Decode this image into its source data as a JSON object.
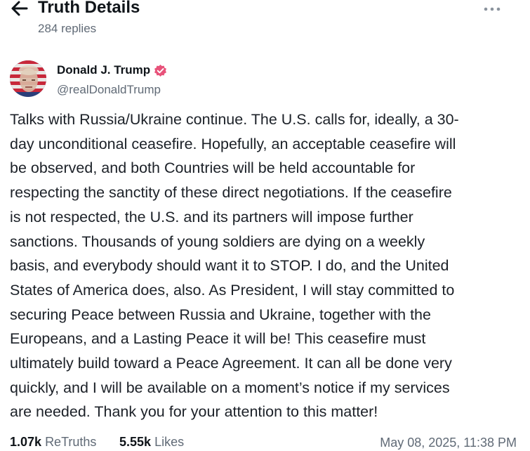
{
  "header": {
    "title": "Truth Details",
    "subtitle": "284 replies",
    "back_icon": "arrow-left-icon",
    "more_icon": "ellipsis-icon"
  },
  "author": {
    "name": "Donald J. Trump",
    "handle": "@realDonaldTrump",
    "verified": true,
    "verified_color": "#e8527a"
  },
  "post": {
    "text": "Talks with Russia/Ukraine continue. The U.S. calls for, ideally, a 30-\nday unconditional ceasefire. Hopefully, an acceptable ceasefire will\nbe observed, and both Countries will be held accountable for\nrespecting the sanctity of these direct negotiations. If the ceasefire\nis not respected, the U.S. and its partners will impose further\nsanctions. Thousands of young soldiers are dying on a weekly\nbasis, and everybody should want it to STOP. I do, and the United\nStates of America does, also. As President, I will stay committed to\nsecuring Peace between Russia and Ukraine, together with the\nEuropeans, and a Lasting Peace it will be! This ceasefire must\nultimately build toward a Peace Agreement. It can all be done very\nquickly, and I will be available on a moment’s notice if my services\nare needed. Thank you for your attention to this matter!"
  },
  "stats": {
    "retruths_count": "1.07k",
    "retruths_label": "ReTruths",
    "likes_count": "5.55k",
    "likes_label": "Likes",
    "timestamp": "May 08, 2025, 11:38 PM"
  },
  "colors": {
    "text": "#0f1419",
    "muted": "#606a76",
    "background": "#ffffff"
  }
}
